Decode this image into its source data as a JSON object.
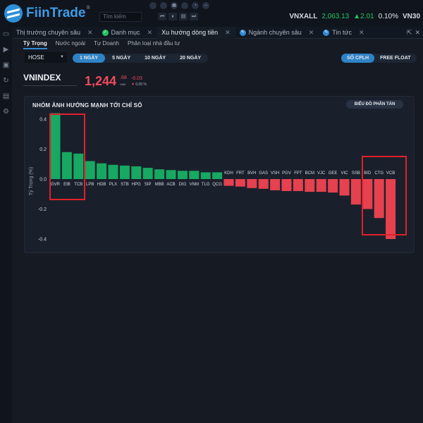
{
  "app": {
    "logo_text": "FiinTrade",
    "logo_tm": "®"
  },
  "search": {
    "placeholder": "Tìm kiếm"
  },
  "topbar": {
    "ticker_name": "VNXALL",
    "ticker_value": "2,063.13",
    "ticker_change": "▲2.01",
    "ticker_pct": "0.10%",
    "ticker2_name": "VN30"
  },
  "tabs": [
    {
      "label": "Thị trường chuyên sâu",
      "icon": "",
      "icon_color": ""
    },
    {
      "label": "Danh mục",
      "icon": "check-icon",
      "icon_color": "#22c55e"
    },
    {
      "label": "Xu hướng dòng tiền",
      "icon": "",
      "icon_color": ""
    },
    {
      "label": "Ngành chuyên sâu",
      "icon": "pen-icon",
      "icon_color": "#2f8bd8"
    },
    {
      "label": "Tin tức",
      "icon": "pen-icon",
      "icon_color": "#2f8bd8"
    }
  ],
  "subtabs": [
    "Tỷ Trọng",
    "Nước ngoài",
    "Tự Doanh",
    "Phân loại nhà đầu tư"
  ],
  "exchange": {
    "selected": "HOSE"
  },
  "ranges": [
    "1 NGÀY",
    "5 NGÀY",
    "10 NGÀY",
    "20 NGÀY"
  ],
  "toggles": [
    "SỐ CPLH",
    "FREE FLOAT"
  ],
  "index": {
    "name": "VNINDEX",
    "value": "1,244",
    "decimals": ".68",
    "unit": "VND",
    "change": "-0.03",
    "pct": "0.00 %"
  },
  "panel": {
    "title": "NHÓM ẢNH HƯỞNG MẠNH TỚI CHỈ SỐ",
    "button": "BIỂU ĐỒ PHÂN TÁN"
  },
  "colors": {
    "positive": "#17a862",
    "negative": "#e5414f",
    "highlight": "#e0202c",
    "accent": "#2e83c7"
  },
  "chart_data": {
    "type": "bar",
    "ylabel": "Tỷ Trọng (%)",
    "ylim": [
      -0.45,
      0.5
    ],
    "yticks": [
      0.4,
      0.2,
      0,
      -0.2,
      -0.4
    ],
    "grid": false,
    "categories": [
      "GVR",
      "EIB",
      "TCB",
      "LPB",
      "HDB",
      "PLX",
      "STB",
      "HPG",
      "SIP",
      "MBB",
      "ACB",
      "DIG",
      "VNM",
      "TLG",
      "QCG",
      "KDH",
      "FRT",
      "BVH",
      "GAS",
      "VSH",
      "PGV",
      "FPT",
      "BCM",
      "VJC",
      "GEE",
      "VIC",
      "SSB",
      "BID",
      "CTG",
      "VCB"
    ],
    "values": [
      0.44,
      0.18,
      0.17,
      0.12,
      0.105,
      0.095,
      0.09,
      0.085,
      0.075,
      0.065,
      0.06,
      0.055,
      0.055,
      0.045,
      0.045,
      -0.045,
      -0.05,
      -0.06,
      -0.065,
      -0.075,
      -0.08,
      -0.08,
      -0.085,
      -0.085,
      -0.09,
      -0.11,
      -0.17,
      -0.2,
      -0.26,
      -0.4
    ]
  }
}
